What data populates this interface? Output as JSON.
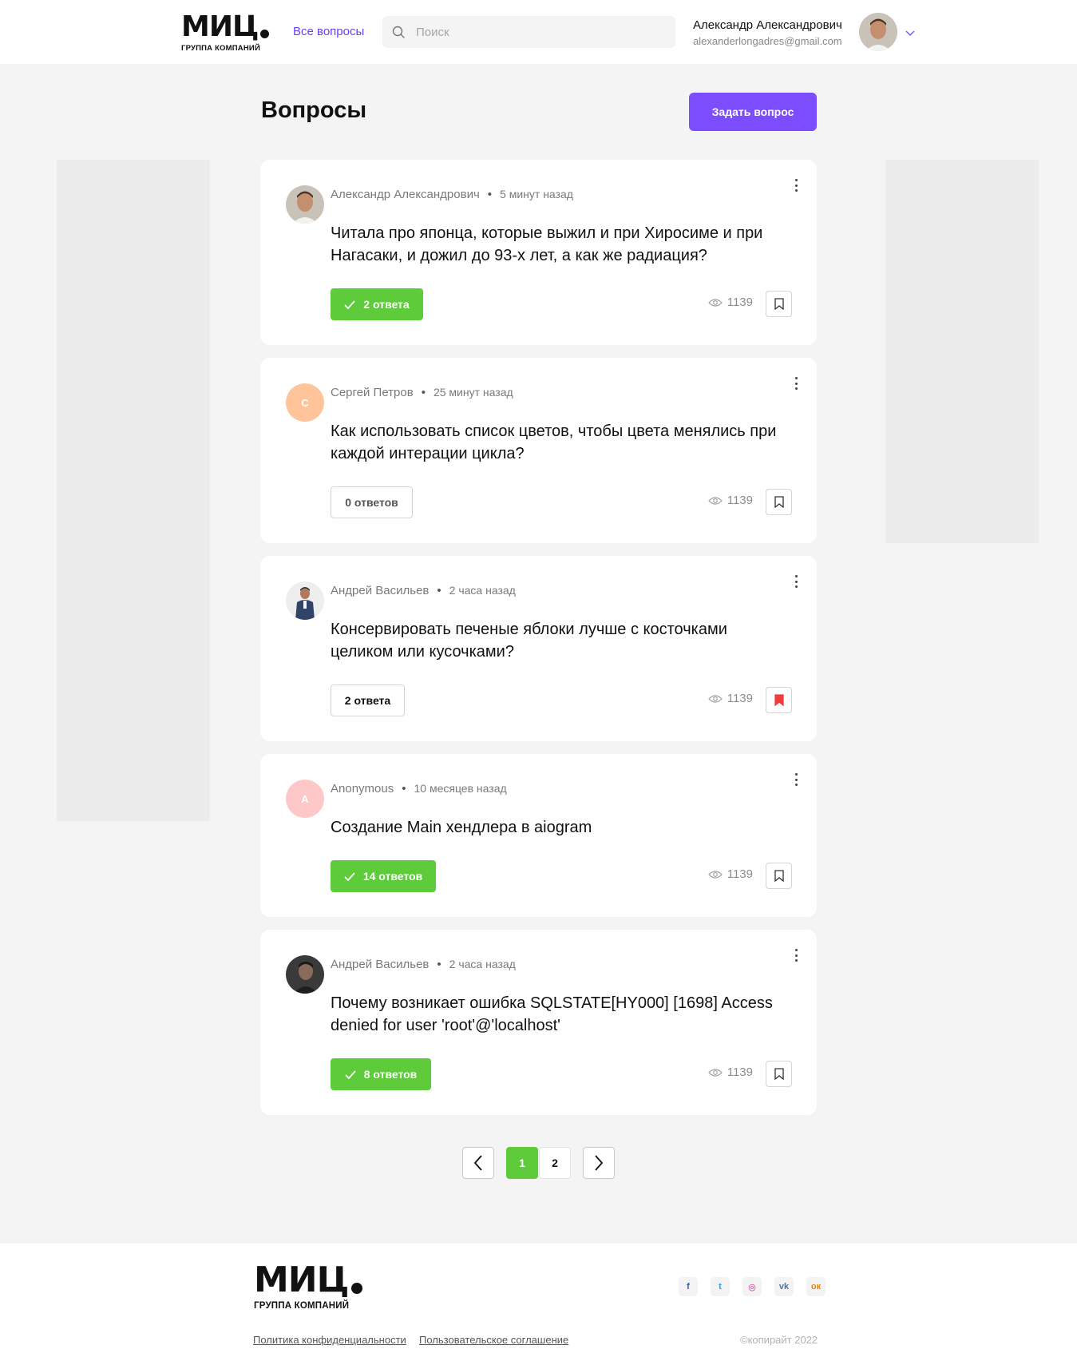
{
  "logo": {
    "big": "МИЦ",
    "small": "ГРУППА КОМПАНИЙ"
  },
  "nav": {
    "all_questions": "Все вопросы"
  },
  "search": {
    "placeholder": "Поиск"
  },
  "user": {
    "name": "Александр Александрович",
    "email": "alexanderlongadres@gmail.com"
  },
  "page": {
    "title": "Вопросы",
    "ask_button": "Задать вопрос"
  },
  "questions": [
    {
      "author": "Александр Александрович",
      "time": "5 минут назад",
      "title": "Читала про японца, которые выжил и при Хиросиме и при Нагасаки, и дожил до 93-х лет, а как же радиация?",
      "answers": "2 ответа",
      "answers_state": "accepted",
      "views": "1139",
      "bookmarked": false
    },
    {
      "author": "Сергей Петров",
      "initial": "С",
      "time": "25 минут назад",
      "title": "Как использовать список цветов, чтобы цвета менялись при каждой интерации цикла?",
      "answers": "0 ответов",
      "answers_state": "none",
      "views": "1139",
      "bookmarked": false
    },
    {
      "author": "Андрей Васильев",
      "time": "2 часа назад",
      "title": "Консервировать печеные яблоки лучше с косточками целиком или кусочками?",
      "answers": "2 ответа",
      "answers_state": "open",
      "views": "1139",
      "bookmarked": true
    },
    {
      "author": "Anonymous",
      "initial": "А",
      "time": "10 месяцев назад",
      "title": "Создание Main хендлера в aiogram",
      "answers": "14 ответов",
      "answers_state": "accepted",
      "views": "1139",
      "bookmarked": false
    },
    {
      "author": "Андрей Васильев",
      "time": "2 часа назад",
      "title": "Почему возникает ошибка SQLSTATE[HY000] [1698] Access denied for user 'root'@'localhost'",
      "answers": "8 ответов",
      "answers_state": "accepted",
      "views": "1139",
      "bookmarked": false
    }
  ],
  "pagination": {
    "pages": [
      "1",
      "2"
    ],
    "current": "1"
  },
  "footer": {
    "privacy": "Политика конфиденциальности",
    "agreement": "Пользовательское соглашение",
    "copyright": "©копирайт 2022",
    "socials": [
      {
        "icon": "facebook-icon",
        "glyph": "f",
        "color": "#3b5998"
      },
      {
        "icon": "twitter-icon",
        "glyph": "t",
        "color": "#1da1f2"
      },
      {
        "icon": "instagram-icon",
        "glyph": "◎",
        "color": "#d6249f"
      },
      {
        "icon": "vk-icon",
        "glyph": "vk",
        "color": "#4c75a3"
      },
      {
        "icon": "odnoklassniki-icon",
        "glyph": "ок",
        "color": "#ee8208"
      }
    ]
  },
  "colors": {
    "accent": "#7c4dff",
    "success": "#5ecb3b",
    "bookmark_active": "#f03c3c",
    "link": "#6a3ff2"
  }
}
